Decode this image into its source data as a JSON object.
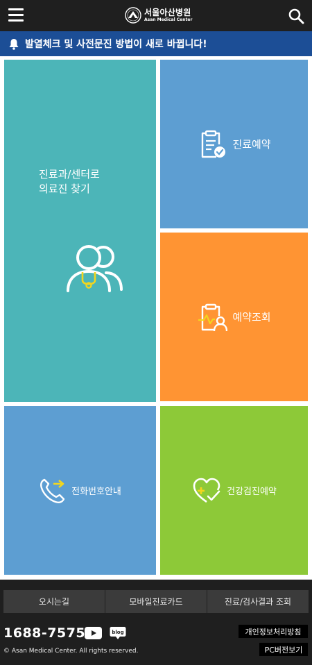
{
  "header": {
    "logo": {
      "ko": "서울아산병원",
      "en": "Asan Medical Center"
    },
    "menu_icon": "hamburger-menu-icon",
    "search_icon": "search-icon"
  },
  "notice": {
    "icon": "bell-icon",
    "text": "발열체크 및 사전문진 방법이 새로 바뀝니다!"
  },
  "tiles": [
    {
      "id": "doctors",
      "line1": "진료과/센터로",
      "line2": "의료진 찾기",
      "icon": "doctor-stethoscope-icon",
      "color": "#4cb5b8"
    },
    {
      "id": "reservation",
      "label": "진료예약",
      "icon": "clipboard-check-icon",
      "color": "#5d9ed2"
    },
    {
      "id": "check",
      "label": "예약조회",
      "icon": "clipboard-person-icon",
      "color": "#ff9433"
    },
    {
      "id": "phone",
      "label": "전화번호안내",
      "icon": "phone-arrow-icon",
      "color": "#5d9ed2"
    },
    {
      "id": "health",
      "label": "건강검진예약",
      "icon": "heart-check-icon",
      "color": "#8dc938"
    }
  ],
  "footer": {
    "nav": [
      "오시는길",
      "모바일진료카드",
      "진료/검사결과 조회"
    ],
    "phone": "1688-7575",
    "youtube_icon": "youtube-icon",
    "blog_icon": "blog-icon",
    "blog_text": "blog",
    "privacy": "개인정보처리방침",
    "pc_view": "PC버전보기",
    "copyright": "© Asan Medical Center. All rights reserved."
  },
  "colors": {
    "header_bg": "#1f1f1f",
    "notice_bg": "#1c4e96",
    "accent_yellow": "#f2d61f"
  }
}
